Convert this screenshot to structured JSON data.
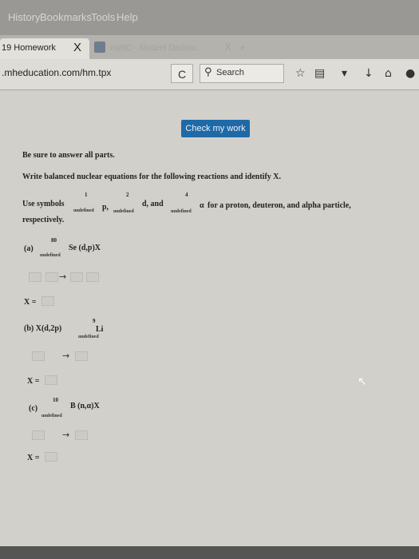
{
  "menubar": {
    "items": [
      "History",
      "Bookmarks",
      "Tools",
      "Help"
    ]
  },
  "tabs": {
    "active_title": "19 Homework",
    "active_close": "X",
    "second_title": "myBC - Student Dashbo...",
    "second_close": "X",
    "new_tab": "+"
  },
  "address": {
    "url": ".mheducation.com/hm.tpx",
    "reload": "C",
    "search_placeholder": "Search"
  },
  "page": {
    "check_button": "Check my work",
    "instruction_1": "Be sure to answer all parts.",
    "instruction_2": "Write balanced nuclear equations for the following reactions and identify X.",
    "use_symbols": "Use symbols",
    "sym1_num": "1",
    "sym1_und": "undefined",
    "sym1_letter": "p,",
    "sym2_num": "2",
    "sym2_und": "undefined",
    "sym2_letter": "d, and",
    "sym3_num": "4",
    "sym3_und": "undefined",
    "sym3_letter": "α",
    "for_text": "for a proton, deuteron, and alpha particle,",
    "respectively": "respectively.",
    "a_label": "(a)",
    "a_num": "80",
    "a_und": "undefined",
    "a_reaction": "Se (d,p)X",
    "a_arrow": "→",
    "x_label_a": "X =",
    "b_label": "(b) X(d,2p)",
    "b_num": "9",
    "b_und": "undefined",
    "b_element": "Li",
    "b_arrow": "→",
    "x_label_b": "X =",
    "c_label": "(c)",
    "c_num": "10",
    "c_und": "undefined",
    "c_reaction": "B (n,α)X",
    "c_arrow": "→",
    "x_label_c": "X ="
  },
  "colors": {
    "check_button": "#1e6aa6",
    "page_bg": "#d2d0cb"
  }
}
